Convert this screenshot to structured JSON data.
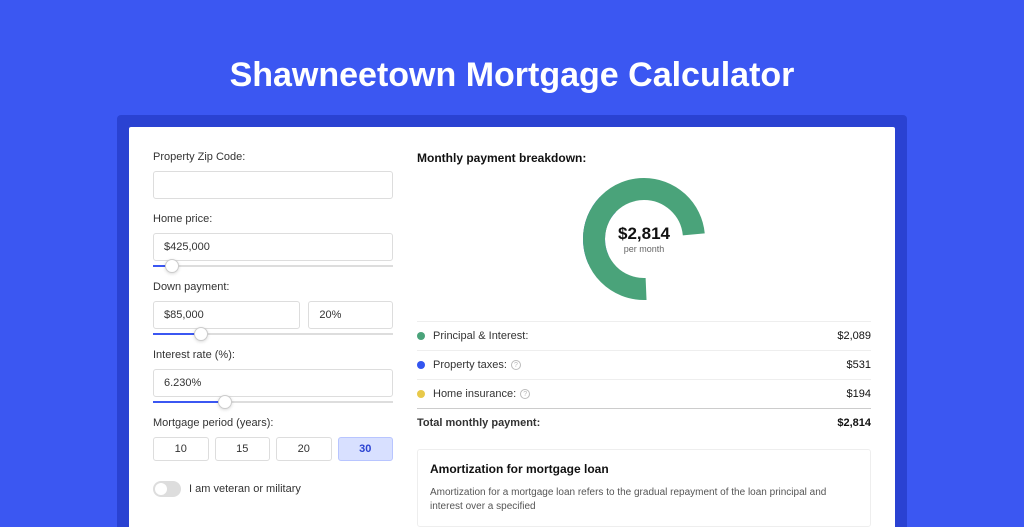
{
  "page": {
    "title": "Shawneetown Mortgage Calculator"
  },
  "form": {
    "zip_label": "Property Zip Code:",
    "zip_value": "",
    "home_price_label": "Home price:",
    "home_price_value": "$425,000",
    "home_price_slider_pct": 8,
    "down_payment_label": "Down payment:",
    "down_payment_value": "$85,000",
    "down_payment_pct_value": "20%",
    "down_payment_slider_pct": 20,
    "interest_label": "Interest rate (%):",
    "interest_value": "6.230%",
    "interest_slider_pct": 30,
    "period_label": "Mortgage period (years):",
    "periods": [
      "10",
      "15",
      "20",
      "30"
    ],
    "period_active": "30",
    "veteran_label": "I am veteran or military"
  },
  "breakdown": {
    "title": "Monthly payment breakdown:",
    "center_amount": "$2,814",
    "center_sub": "per month",
    "items": [
      {
        "label": "Principal & Interest:",
        "value": "$2,089",
        "color": "green",
        "help": false
      },
      {
        "label": "Property taxes:",
        "value": "$531",
        "color": "blue",
        "help": true
      },
      {
        "label": "Home insurance:",
        "value": "$194",
        "color": "yellow",
        "help": true
      }
    ],
    "total_label": "Total monthly payment:",
    "total_value": "$2,814"
  },
  "amortization": {
    "title": "Amortization for mortgage loan",
    "text": "Amortization for a mortgage loan refers to the gradual repayment of the loan principal and interest over a specified"
  },
  "chart_data": {
    "type": "pie",
    "title": "Monthly payment breakdown",
    "series": [
      {
        "name": "Principal & Interest",
        "value": 2089,
        "color": "#4aa37a"
      },
      {
        "name": "Property taxes",
        "value": 531,
        "color": "#3355f0"
      },
      {
        "name": "Home insurance",
        "value": 194,
        "color": "#e8c94a"
      }
    ],
    "total": 2814,
    "center_label": "$2,814 per month"
  }
}
